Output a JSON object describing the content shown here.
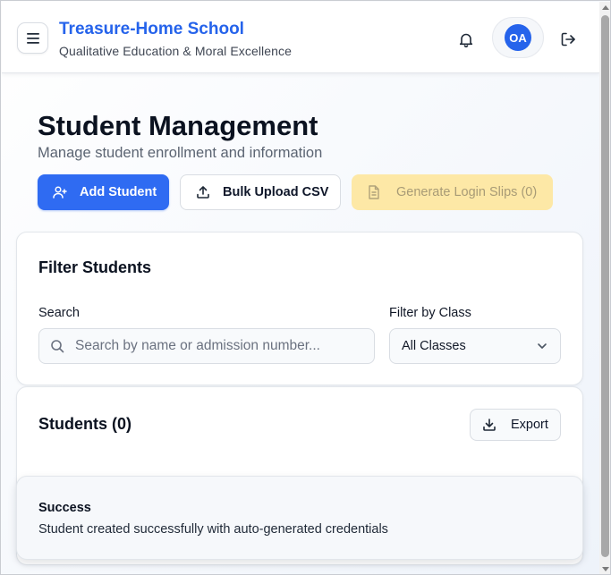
{
  "header": {
    "school_name": "Treasure-Home School",
    "tagline": "Qualitative Education & Moral Excellence",
    "avatar_initials": "OA",
    "icons": [
      "menu-icon",
      "bell-icon",
      "logout-icon"
    ]
  },
  "page": {
    "title": "Student Management",
    "subtitle": "Manage student enrollment and information"
  },
  "actions": {
    "add_student": "Add Student",
    "bulk_upload": "Bulk Upload CSV",
    "generate_slips": "Generate Login Slips (0)"
  },
  "filter": {
    "title": "Filter Students",
    "search_label": "Search",
    "search_placeholder": "Search by name or admission number...",
    "search_value": "",
    "class_label": "Filter by Class",
    "class_selected": "All Classes"
  },
  "students": {
    "title": "Students (0)",
    "export_label": "Export"
  },
  "toast": {
    "title": "Success",
    "message": "Student created successfully with auto-generated credentials"
  },
  "colors": {
    "brand": "#2563eb",
    "primary_button": "#2f6bf2",
    "disabled_button": "#fde8a6"
  }
}
